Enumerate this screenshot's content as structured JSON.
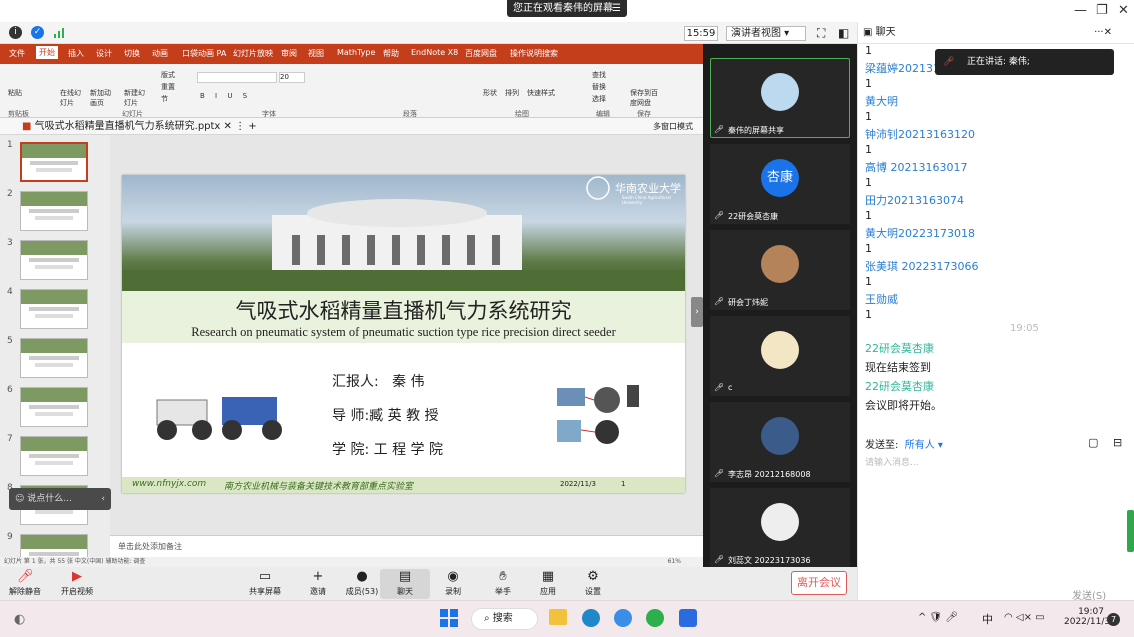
{
  "share_banner": {
    "text": "您正在观看秦伟的屏幕",
    "icon": "menu-icon"
  },
  "meeting_bar": {
    "timer": "15:59",
    "view_mode": "演讲者视图",
    "chat_title": "聊天",
    "chat_close": "···✕"
  },
  "ppt": {
    "ribbon_tabs": [
      "文件",
      "开始",
      "插入",
      "设计",
      "切换",
      "动画",
      "口袋动画 PA",
      "幻灯片放映",
      "审阅",
      "视图",
      "MathType",
      "帮助",
      "EndNote X8",
      "百度网盘",
      "操作说明搜索"
    ],
    "ribbon_groups": [
      "剪贴板",
      "幻灯片",
      "字体",
      "段落",
      "绘图",
      "编辑",
      "保存"
    ],
    "ribbon_buttons": {
      "paste": "粘贴",
      "online_slides": "在线幻灯片",
      "new_slide": "新建幻灯片",
      "reuse": "新加动画页",
      "layout": "版式",
      "reset": "重置",
      "section": "节",
      "find": "查找",
      "replace": "替换",
      "select": "选择",
      "save_baidu": "保存到百度网盘",
      "shape": "形状",
      "arrange": "排列",
      "quick_style": "快速样式",
      "font_size": "20"
    },
    "file_tab": "气吸式水稻精量直播机气力系统研究.pptx",
    "multiwin": "多窗口模式",
    "thumb_numbers": [
      "1",
      "2",
      "3",
      "4",
      "5",
      "6",
      "7",
      "8",
      "9"
    ],
    "notes_placeholder": "单击此处添加备注",
    "status": "幻灯片 第 1 张，共 55 张    中文(中国)    辅助功能: 调查",
    "zoom": "61%",
    "comment_placeholder": "说点什么..."
  },
  "slide": {
    "title_cn": "气吸式水稻精量直播机气力系统研究",
    "title_en": "Research on pneumatic system of pneumatic suction type rice precision direct seeder",
    "university_cn": "华南农业大学",
    "university_en": "South China Agricultural University",
    "reporter_label": "汇报人:",
    "reporter": "秦 伟",
    "advisor_label": "导 师:",
    "advisor": "臧 英 教 授",
    "college_label": "学 院:",
    "college": "工 程 学 院",
    "website": "www.nfnyjx.com",
    "lab": "南方农业机械与装备关键技术教育部重点实验室",
    "date": "2022/11/3",
    "page": "1"
  },
  "participants": [
    {
      "label": "秦伟的屏幕共享",
      "avatar_text": ""
    },
    {
      "label": "22研会莫杏康",
      "avatar_text": "杏康"
    },
    {
      "label": "研会丁炜妮",
      "avatar_text": ""
    },
    {
      "label": "c",
      "avatar_text": ""
    },
    {
      "label": "李志昂 20212168008",
      "avatar_text": ""
    },
    {
      "label": "刘蕊文 20223173036",
      "avatar_text": ""
    }
  ],
  "chat": {
    "speaking_tip": "正在讲话: 秦伟;",
    "messages": [
      {
        "name": "",
        "text": "1"
      },
      {
        "name": "梁蕴婷2021316",
        "text": "1"
      },
      {
        "name": "黄大明",
        "text": "1"
      },
      {
        "name": "钟沛钊20213163120",
        "text": "1"
      },
      {
        "name": "高博 20213163017",
        "text": "1"
      },
      {
        "name": "田力20213163074",
        "text": "1"
      },
      {
        "name": "黄大明20223173018",
        "text": "1"
      },
      {
        "name": "张美琪 20223173066",
        "text": "1"
      },
      {
        "name": "王勋威",
        "text": "1"
      }
    ],
    "time_divider": "19:05",
    "late_messages": [
      {
        "name": "22研会莫杏康",
        "text": "现在结束签到"
      },
      {
        "name": "22研会莫杏康",
        "text": "会议即将开始。"
      }
    ],
    "send_to_label": "发送至:",
    "send_to_value": "所有人",
    "input_placeholder": "请输入消息...",
    "send_button": "发送(S)"
  },
  "toolbar": {
    "items": [
      "解除静音",
      "开启视频",
      "共享屏幕",
      "邀请",
      "成员(53)",
      "聊天",
      "录制",
      "举手",
      "应用",
      "设置"
    ],
    "leave": "离开会议"
  },
  "taskbar": {
    "search": "搜索",
    "time": "19:07",
    "date": "2022/11/3",
    "ime": "中"
  },
  "colors": {
    "ppt_accent": "#c43e1c",
    "chat_name": "#2a7ed2",
    "chat_name_alt": "#2fb89b",
    "leave": "#e25b5b"
  }
}
